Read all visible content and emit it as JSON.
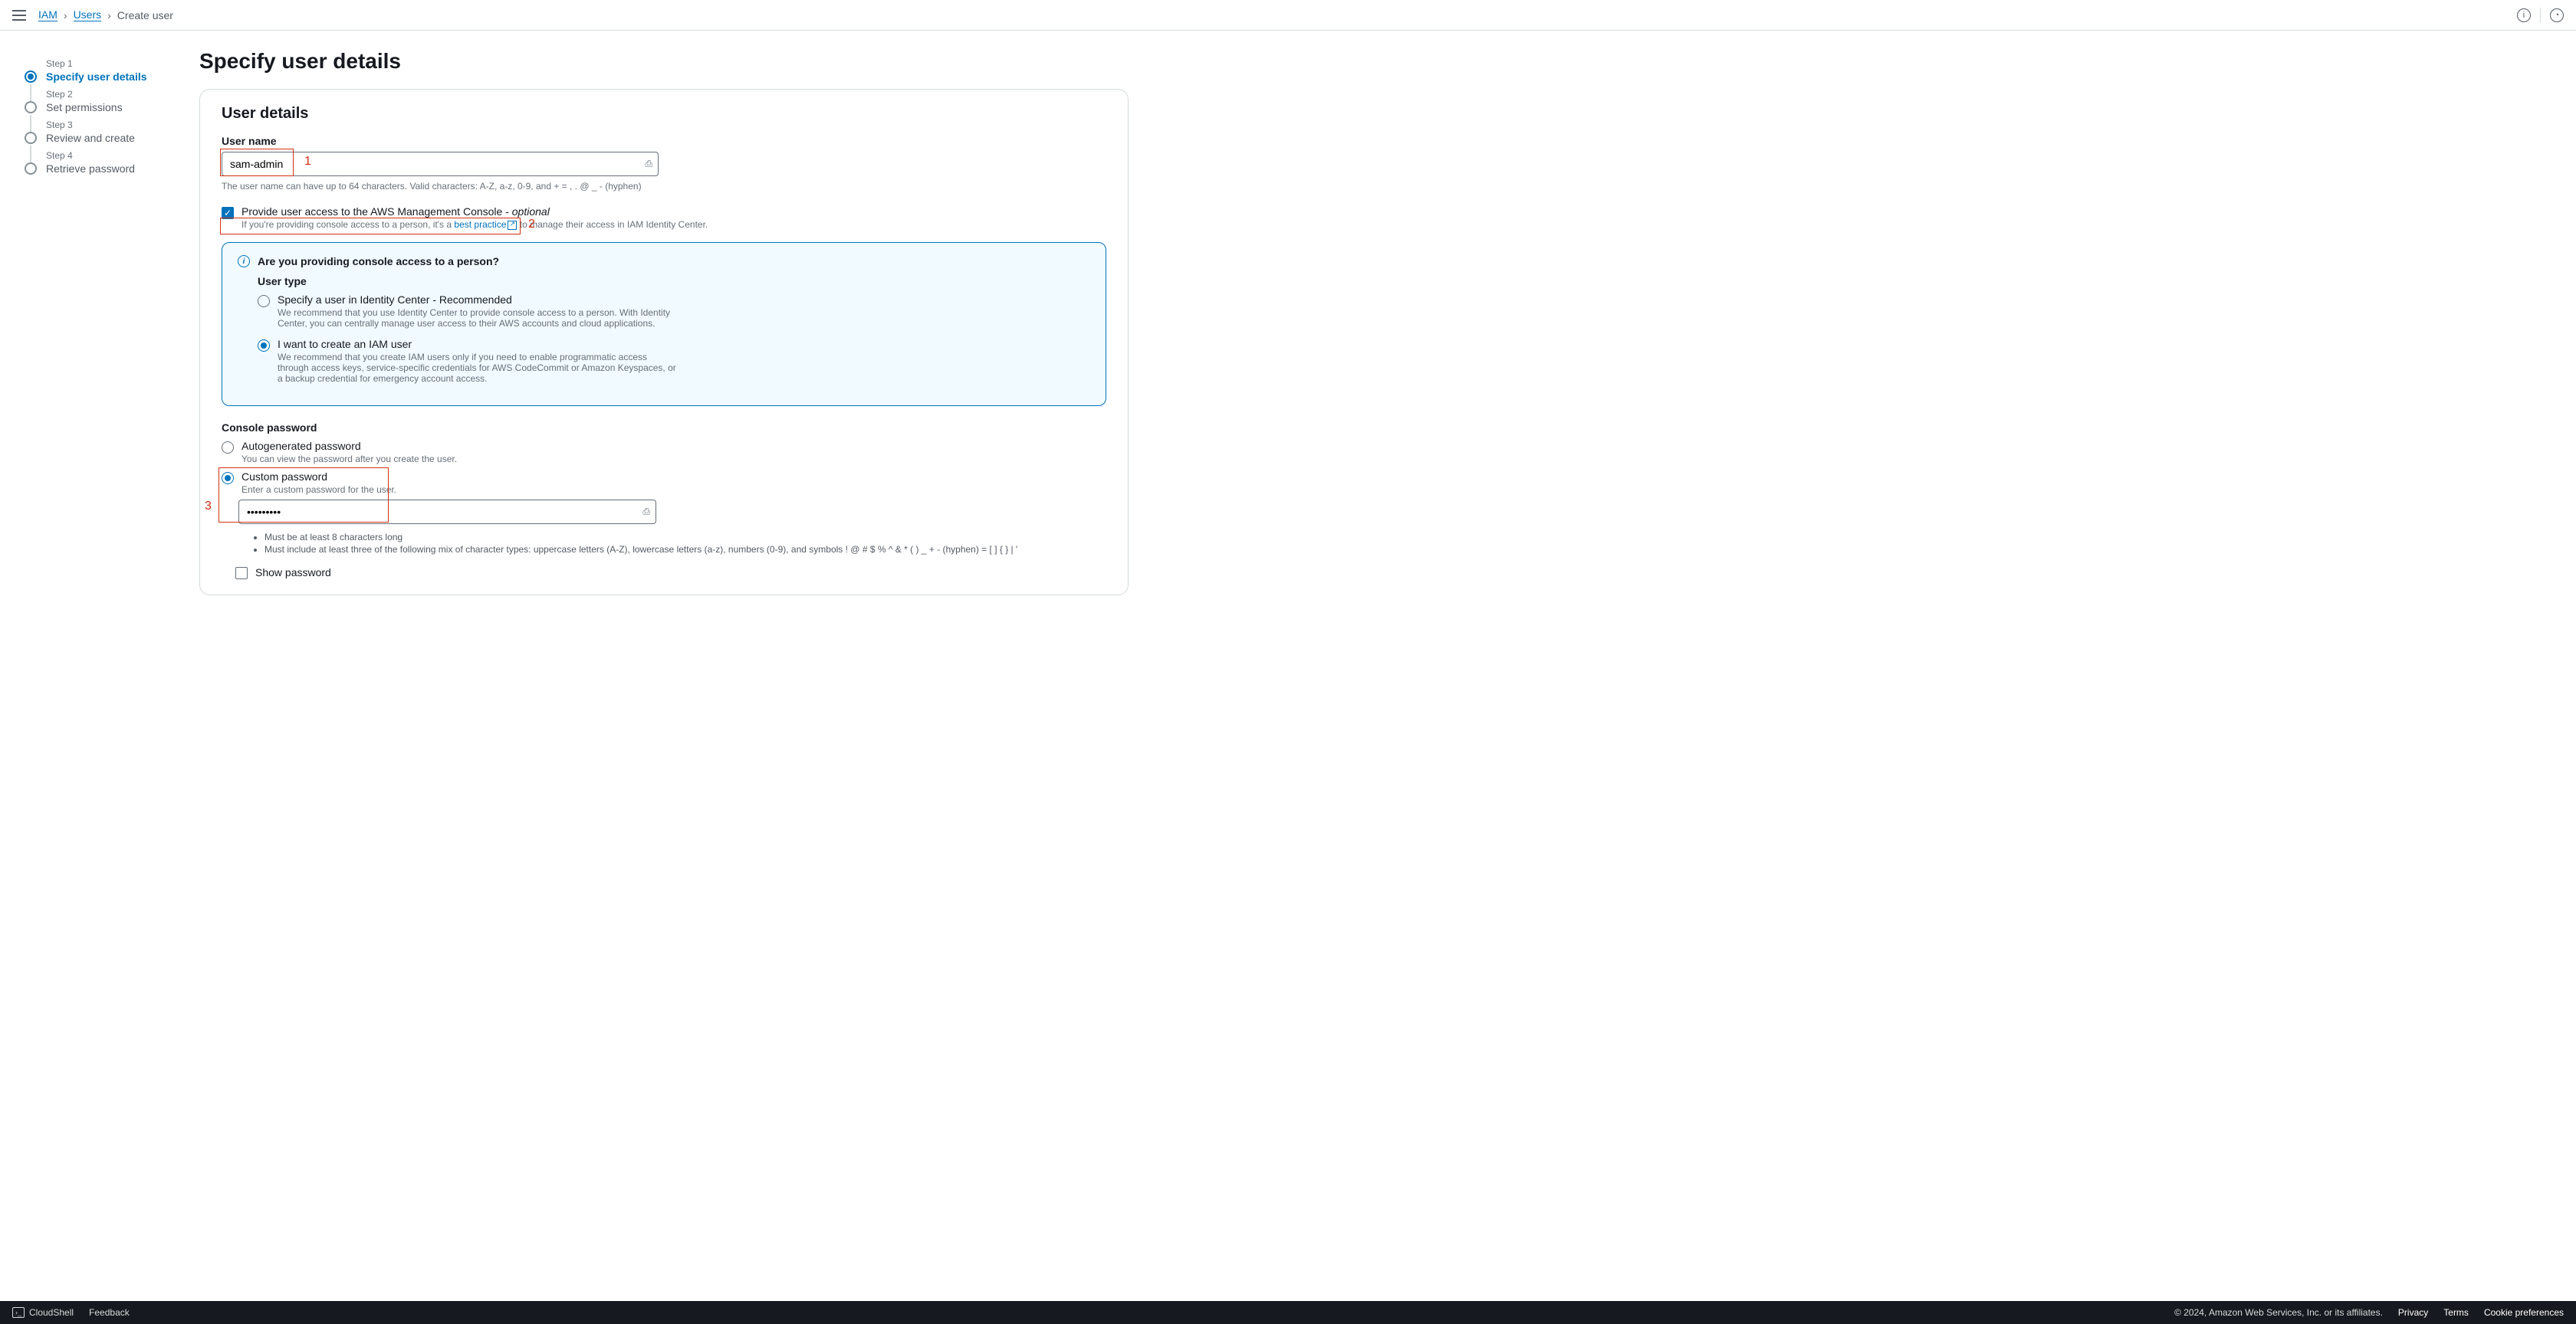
{
  "breadcrumb": {
    "iam": "IAM",
    "users": "Users",
    "current": "Create user"
  },
  "steps": [
    {
      "num": "Step 1",
      "label": "Specify user details"
    },
    {
      "num": "Step 2",
      "label": "Set permissions"
    },
    {
      "num": "Step 3",
      "label": "Review and create"
    },
    {
      "num": "Step 4",
      "label": "Retrieve password"
    }
  ],
  "page_title": "Specify user details",
  "panel_title": "User details",
  "username_label": "User name",
  "username_value": "sam-admin",
  "username_hint": "The user name can have up to 64 characters. Valid characters: A-Z, a-z, 0-9, and + = , . @ _ - (hyphen)",
  "console_access_label": "Provide user access to the AWS Management Console - ",
  "console_access_optional": "optional",
  "console_access_hint_pre": "If you're providing console access to a person, it's a ",
  "console_access_link": "best practice",
  "console_access_hint_post": " to manage their access in IAM Identity Center.",
  "info_header": "Are you providing console access to a person?",
  "user_type_label": "User type",
  "radio_identity_label": "Specify a user in Identity Center - Recommended",
  "radio_identity_hint": "We recommend that you use Identity Center to provide console access to a person. With Identity Center, you can centrally manage user access to their AWS accounts and cloud applications.",
  "radio_iam_label": "I want to create an IAM user",
  "radio_iam_hint": "We recommend that you create IAM users only if you need to enable programmatic access through access keys, service-specific credentials for AWS CodeCommit or Amazon Keyspaces, or a backup credential for emergency account access.",
  "console_pw_label": "Console password",
  "radio_auto_label": "Autogenerated password",
  "radio_auto_hint": "You can view the password after you create the user.",
  "radio_custom_label": "Custom password",
  "radio_custom_hint": "Enter a custom password for the user.",
  "password_value": "•••••••••",
  "pw_req1": "Must be at least 8 characters long",
  "pw_req2": "Must include at least three of the following mix of character types: uppercase letters (A-Z), lowercase letters (a-z), numbers (0-9), and symbols ! @ # $ % ^ & * ( ) _ + - (hyphen) = [ ] { } | '",
  "show_pw_label": "Show password",
  "annotations": {
    "a1": "1",
    "a2": "2",
    "a3": "3"
  },
  "footer": {
    "cloudshell": "CloudShell",
    "feedback": "Feedback",
    "copyright": "© 2024, Amazon Web Services, Inc. or its affiliates.",
    "privacy": "Privacy",
    "terms": "Terms",
    "cookies": "Cookie preferences"
  }
}
